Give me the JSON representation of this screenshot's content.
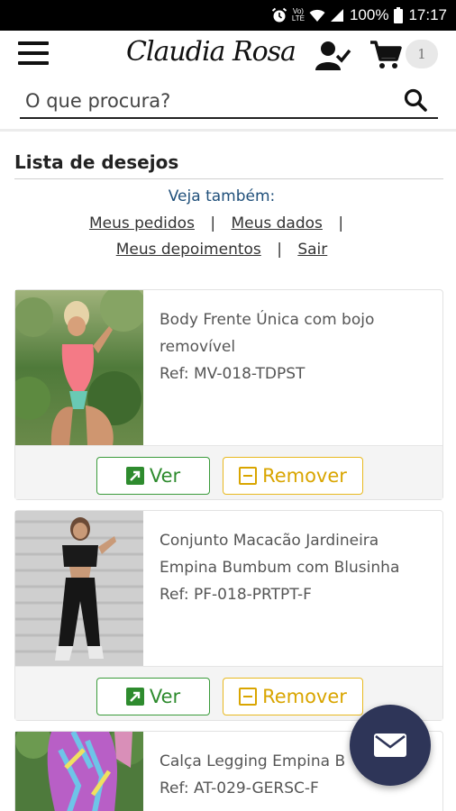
{
  "status_bar": {
    "volte_label_top": "Vo)",
    "volte_label_bottom": "LTE",
    "battery": "100%",
    "time": "17:17",
    "icons": [
      "alarm-icon",
      "volte-icon",
      "wifi-icon",
      "signal-icon",
      "battery-icon"
    ]
  },
  "header": {
    "logo_text": "Claudia Rosa",
    "cart_count": "1",
    "icons": [
      "menu-icon",
      "user-check-icon",
      "cart-icon"
    ]
  },
  "search": {
    "placeholder": "O que procura?",
    "icon": "search-icon"
  },
  "page": {
    "title": "Lista de desejos",
    "see_also_label": "Veja também:",
    "links": {
      "orders": "Meus pedidos",
      "data": "Meus dados",
      "testimonials": "Meus depoimentos",
      "logout": "Sair"
    },
    "separator": "|"
  },
  "wishlist": [
    {
      "name": "Body Frente Única com bojo removível",
      "ref": "Ref: MV-018-TDPST",
      "view_label": "Ver",
      "remove_label": "Remover"
    },
    {
      "name": "Conjunto Macacão Jardineira Empina Bumbum com Blusinha",
      "ref": "Ref: PF-018-PRTPT-F",
      "view_label": "Ver",
      "remove_label": "Remover"
    },
    {
      "name": "Calça Legging Empina B",
      "ref": "Ref: AT-029-GERSC-F"
    }
  ],
  "colors": {
    "link_blue": "#1f4f7a",
    "view_green": "#2e8b2e",
    "remove_yellow": "#d9a500",
    "fab": "#2e3558"
  },
  "fab": {
    "icon": "mail-icon"
  }
}
